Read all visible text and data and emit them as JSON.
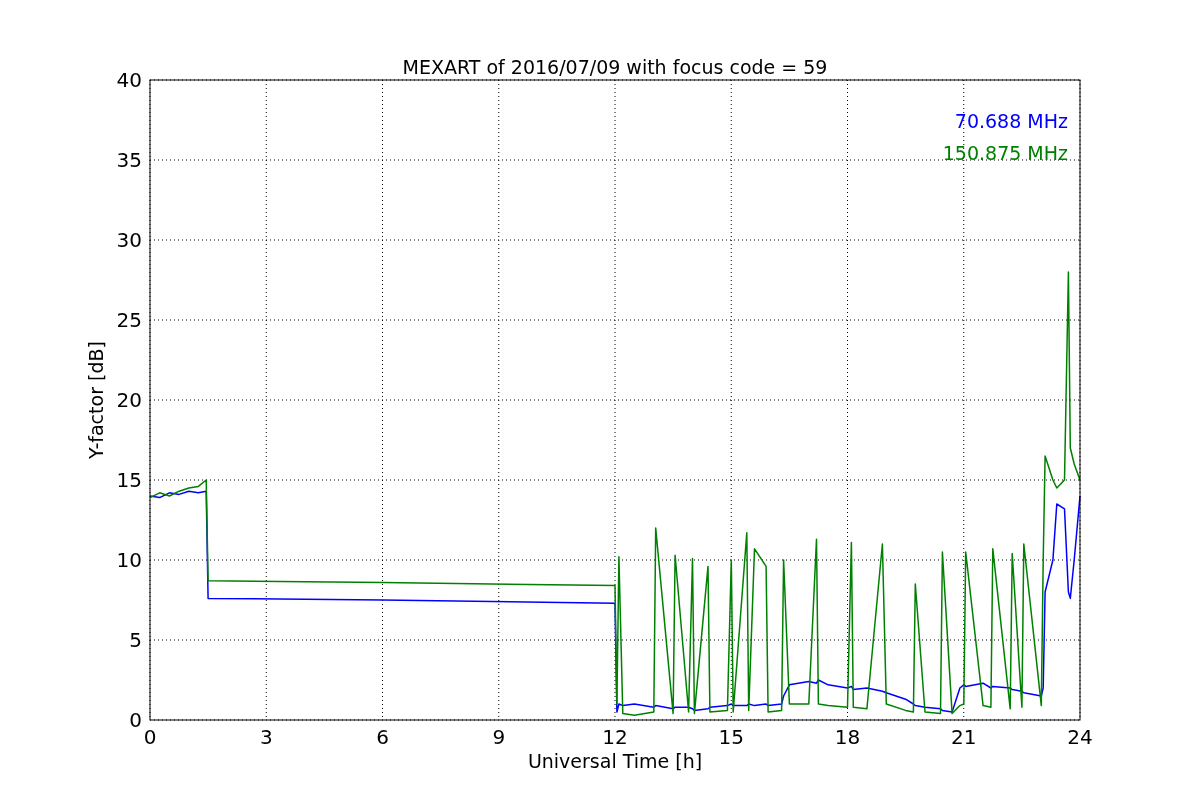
{
  "chart_data": {
    "type": "line",
    "title": "MEXART of 2016/07/09 with focus code = 59",
    "xlabel": "Universal Time [h]",
    "ylabel": "Y-factor [dB]",
    "x": [
      0,
      0.25,
      0.5,
      0.75,
      1,
      1.25,
      1.45,
      1.5,
      6,
      12,
      12.05,
      12.1,
      12.2,
      12.5,
      13,
      13.05,
      13.5,
      13.55,
      13.9,
      14,
      14.05,
      14.4,
      14.45,
      14.9,
      15,
      15.05,
      15.4,
      15.45,
      15.6,
      15.9,
      15.95,
      16.3,
      16.35,
      16.5,
      17,
      17.2,
      17.25,
      17.5,
      18,
      18.1,
      18.15,
      18.5,
      18.9,
      19,
      19.5,
      19.7,
      19.75,
      20,
      20.4,
      20.45,
      20.7,
      20.9,
      21,
      21.05,
      21.5,
      21.7,
      21.75,
      22.2,
      22.25,
      22.5,
      22.55,
      23,
      23.05,
      23.1,
      23.3,
      23.4,
      23.6,
      23.7,
      23.75,
      23.85,
      24
    ],
    "series": [
      {
        "name": "70.688 MHz",
        "color": "#0000ff",
        "values": [
          14,
          13.9,
          14.2,
          14.1,
          14.3,
          14.2,
          14.3,
          7.6,
          7.5,
          7.3,
          0.5,
          1,
          0.9,
          1,
          0.8,
          0.9,
          0.7,
          0.8,
          0.8,
          0.7,
          0.6,
          0.7,
          0.8,
          0.9,
          1,
          0.9,
          0.9,
          1,
          0.9,
          1,
          0.9,
          1,
          1.5,
          2.2,
          2.4,
          2.3,
          2.5,
          2.2,
          2,
          2.1,
          1.9,
          2,
          1.8,
          1.7,
          1.3,
          1,
          0.9,
          0.8,
          0.7,
          0.6,
          0.5,
          2,
          2.2,
          2.1,
          2.3,
          2,
          2.1,
          2,
          1.9,
          1.8,
          1.7,
          1.5,
          2,
          8,
          10,
          13.5,
          13.2,
          8,
          7.6,
          10,
          14
        ]
      },
      {
        "name": "150.875 MHz",
        "color": "#008000",
        "values": [
          13.9,
          14.2,
          14,
          14.3,
          14.5,
          14.6,
          15,
          8.7,
          8.6,
          8.4,
          1,
          10.2,
          0.4,
          0.3,
          0.5,
          12,
          0.4,
          10.3,
          0.5,
          10.1,
          0.4,
          9.6,
          0.5,
          0.6,
          10,
          0.5,
          11.7,
          0.6,
          10.7,
          9.6,
          0.5,
          0.6,
          10,
          1,
          1,
          11.3,
          1,
          0.9,
          0.8,
          11.1,
          0.8,
          0.7,
          11,
          1,
          0.6,
          0.5,
          8.5,
          0.5,
          0.4,
          10.5,
          0.4,
          0.9,
          1,
          10.5,
          0.9,
          0.8,
          10.7,
          0.7,
          10.4,
          0.8,
          11,
          0.9,
          10,
          16.5,
          15,
          14.5,
          15,
          28,
          17,
          16,
          15
        ]
      }
    ],
    "xlim": [
      0,
      24
    ],
    "ylim": [
      0,
      40
    ],
    "xticks": [
      0,
      3,
      6,
      9,
      12,
      15,
      18,
      21,
      24
    ],
    "yticks": [
      0,
      5,
      10,
      15,
      20,
      25,
      30,
      35,
      40
    ],
    "grid": true
  }
}
